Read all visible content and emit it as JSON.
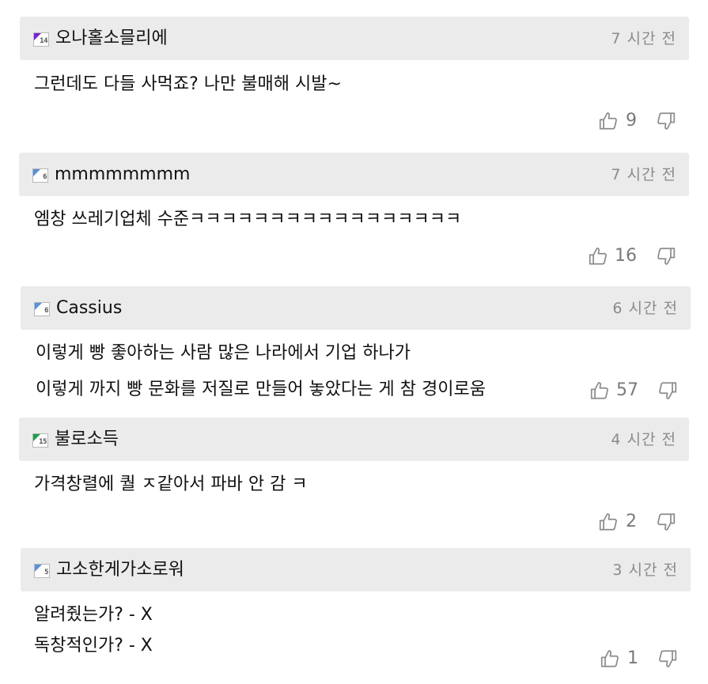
{
  "comments": [
    {
      "level": "14",
      "level_color": "#7a1fd6",
      "username": "오나홀소믈리에",
      "time": "7 시간 전",
      "lines": [
        "그런데도 다들 사먹죠? 나만 불매해 시발~"
      ],
      "likes": "9"
    },
    {
      "level": "6",
      "level_color": "#5b8fd9",
      "username": "mmmmmmmm",
      "time": "7 시간 전",
      "lines": [
        "엠창 쓰레기업체 수준ㅋㅋㅋㅋㅋㅋㅋㅋㅋㅋㅋㅋㅋㅋㅋㅋㅋ"
      ],
      "likes": "16"
    },
    {
      "level": "6",
      "level_color": "#5b8fd9",
      "username": "Cassius",
      "time": "6 시간 전",
      "lines": [
        "이렇게 빵 좋아하는 사람 많은 나라에서 기업 하나가",
        "이렇게 까지 빵 문화를 저질로 만들어 놓았다는 게 참 경이로움"
      ],
      "likes": "57"
    },
    {
      "level": "15",
      "level_color": "#1f9e4a",
      "username": "불로소득",
      "time": "4 시간 전",
      "lines": [
        "가격창렬에 퀄 ㅈ같아서 파바 안 감 ㅋ"
      ],
      "likes": "2"
    },
    {
      "level": "5",
      "level_color": "#5b8fd9",
      "username": "고소한게가소로워",
      "time": "3 시간 전",
      "lines": [
        "알려줬는가? - X",
        "독창적인가? - X"
      ],
      "likes": "1"
    }
  ]
}
